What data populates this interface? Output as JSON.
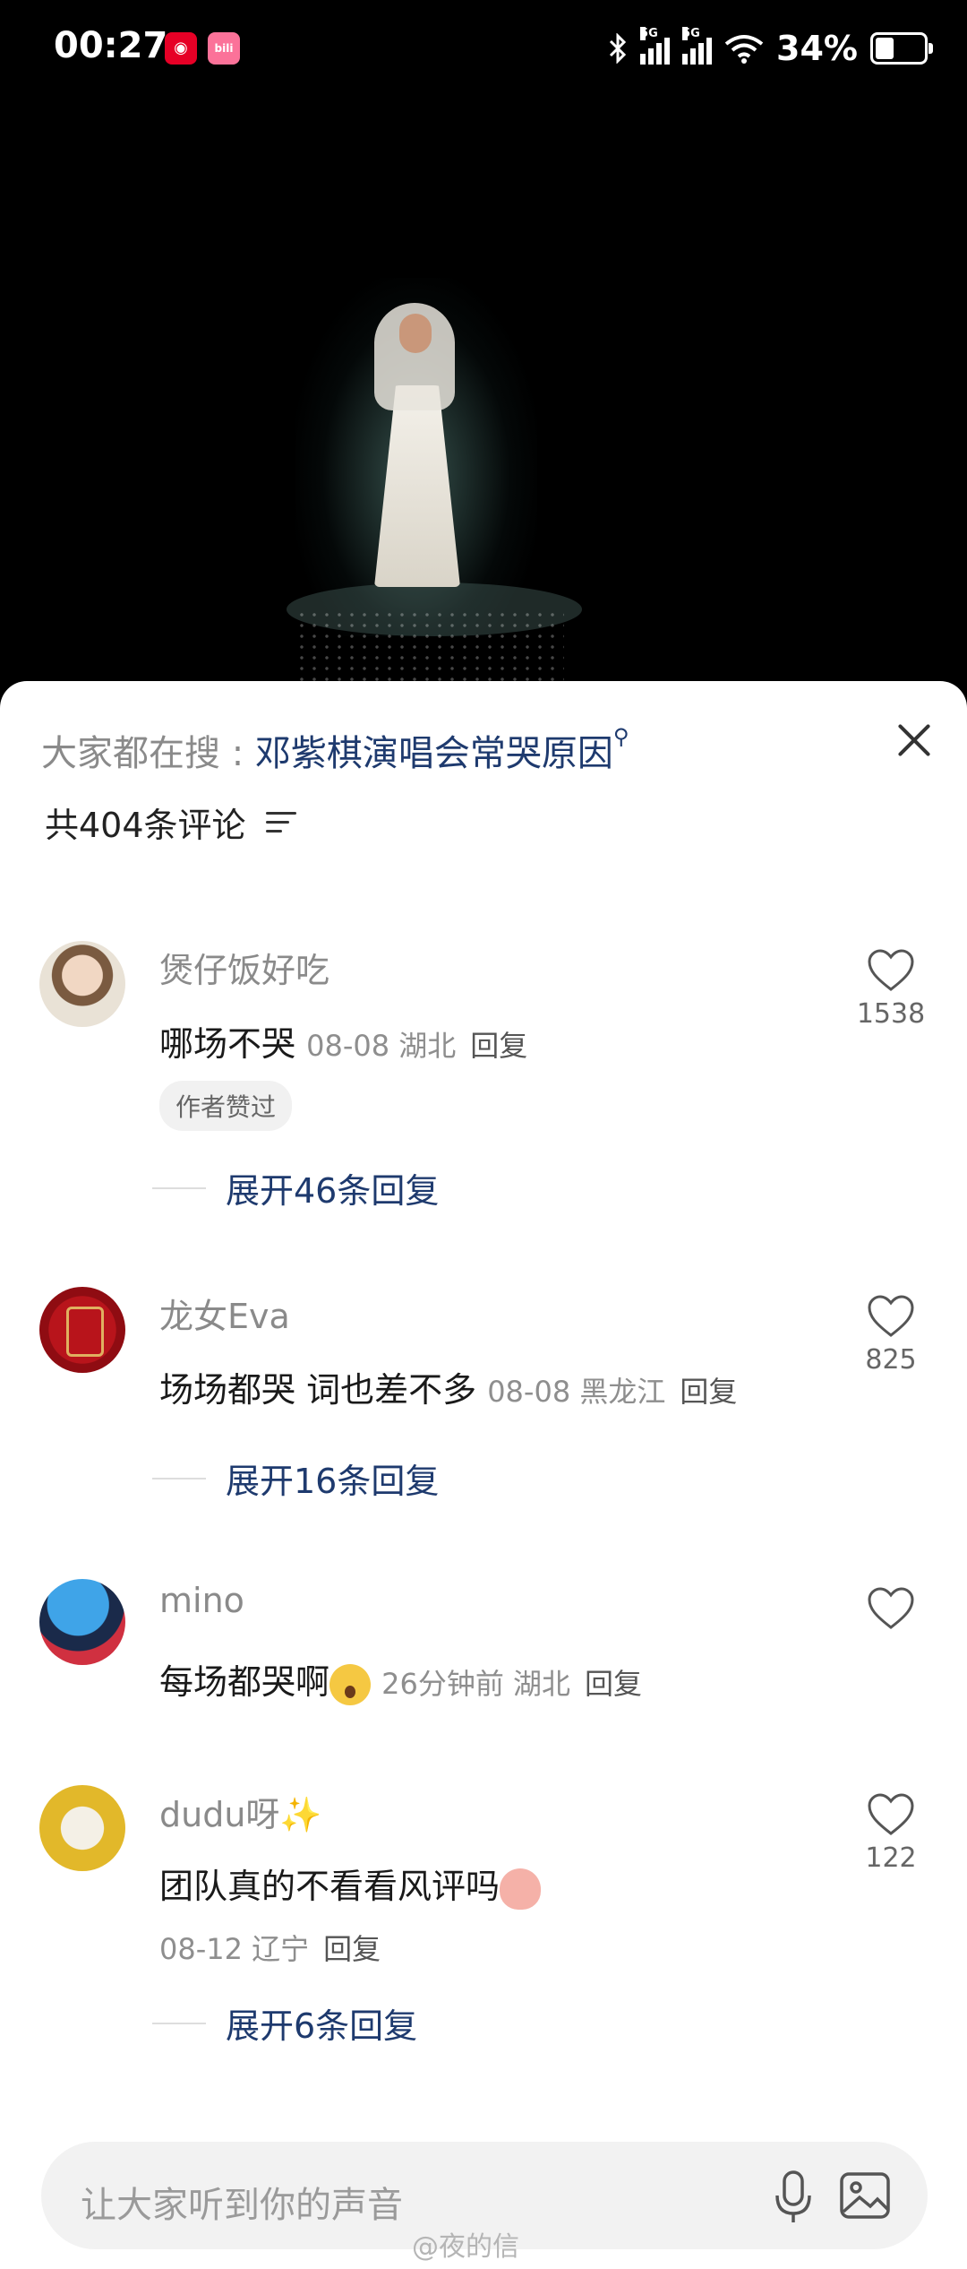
{
  "status_bar": {
    "time": "00:27",
    "app1": "",
    "app2": "bili",
    "network1": "5G",
    "network2": "5G",
    "battery": "34%"
  },
  "comments_sheet": {
    "search_prefix": "大家都在搜 : ",
    "search_keyword": "邓紫棋演唱会常哭原因",
    "count_label": "共404条评论",
    "comments": [
      {
        "user": "煲仔饭好吃",
        "text": "哪场不哭",
        "date": "08-08",
        "location": "湖北",
        "reply": "回复",
        "likes": "1538",
        "tag": "作者赞过",
        "expand": "展开46条回复"
      },
      {
        "user": "龙女Eva",
        "text": "场场都哭 词也差不多",
        "date": "08-08",
        "location": "黑龙江",
        "reply": "回复",
        "likes": "825",
        "expand": "展开16条回复"
      },
      {
        "user": "mino",
        "text": "每场都哭啊",
        "date": "26分钟前",
        "location": "湖北",
        "reply": "回复",
        "likes": ""
      },
      {
        "user": "dudu呀✨",
        "text": "团队真的不看看风评吗",
        "date": "08-12",
        "location": "辽宁",
        "reply": "回复",
        "likes": "122",
        "expand": "展开6条回复"
      }
    ],
    "input_placeholder": "让大家听到你的声音",
    "watermark": "@夜的信"
  },
  "colors": {
    "accent": "#1e3a6e",
    "muted": "#8a8a8a"
  }
}
